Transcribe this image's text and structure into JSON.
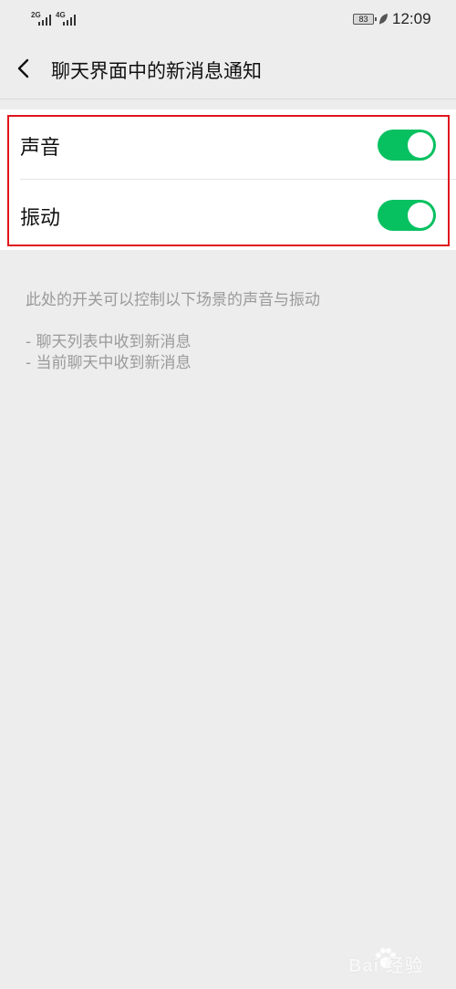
{
  "status_bar": {
    "signal_1_label": "2G",
    "signal_2_label": "4G",
    "battery": "83",
    "time": "12:09"
  },
  "nav": {
    "back_icon": "chevron-left-icon",
    "title": "聊天界面中的新消息通知"
  },
  "settings": [
    {
      "label": "声音",
      "enabled": true
    },
    {
      "label": "振动",
      "enabled": true
    }
  ],
  "toggle_color": "#07c160",
  "description": "此处的开关可以控制以下场景的声音与振动",
  "bullets": [
    "- 聊天列表中收到新消息",
    "- 当前聊天中收到新消息"
  ],
  "watermark": "Bai 经验"
}
